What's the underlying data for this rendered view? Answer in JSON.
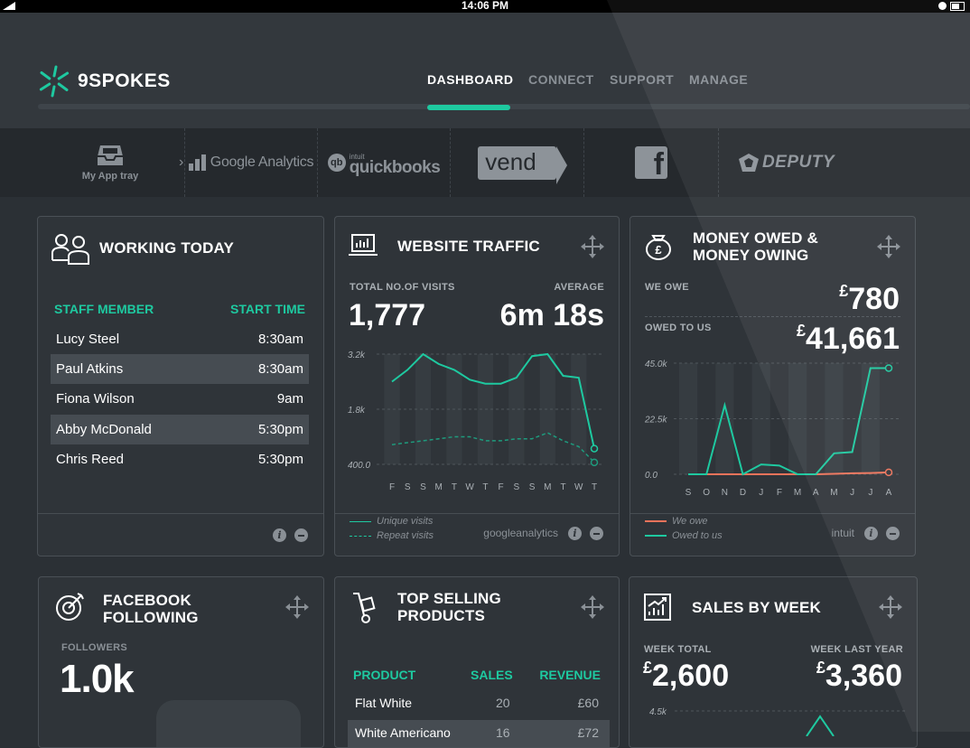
{
  "status_bar": {
    "time": "14:06 PM"
  },
  "brand": {
    "name": "9SPOKES"
  },
  "nav": {
    "tabs": [
      {
        "label": "DASHBOARD",
        "active": true
      },
      {
        "label": "CONNECT",
        "active": false
      },
      {
        "label": "SUPPORT",
        "active": false
      },
      {
        "label": "MANAGE",
        "active": false
      }
    ]
  },
  "apps": {
    "tray_label": "My App tray",
    "items": [
      {
        "name": "Google Analytics",
        "icon": "google-analytics-logo"
      },
      {
        "name": "quickbooks",
        "prefix": "intuit",
        "icon": "quickbooks-logo"
      },
      {
        "name": "vend",
        "icon": "vend-logo"
      },
      {
        "name": "f",
        "icon": "facebook-logo"
      },
      {
        "name": "DEPUTY",
        "icon": "deputy-logo"
      }
    ]
  },
  "working_today": {
    "title": "WORKING TODAY",
    "col_staff": "STAFF MEMBER",
    "col_time": "START TIME",
    "rows": [
      {
        "name": "Lucy Steel",
        "time": "8:30am"
      },
      {
        "name": "Paul Atkins",
        "time": "8:30am"
      },
      {
        "name": "Fiona Wilson",
        "time": "9am"
      },
      {
        "name": "Abby McDonald",
        "time": "5:30pm"
      },
      {
        "name": "Chris Reed",
        "time": "5:30pm"
      }
    ]
  },
  "website_traffic": {
    "title": "WEBSITE TRAFFIC",
    "visits_label": "TOTAL NO.OF VISITS",
    "visits_value": "1,777",
    "average_label": "AVERAGE",
    "average_value": "6m 18s",
    "legend_unique": "Unique visits",
    "legend_repeat": "Repeat visits",
    "source": "googleanalytics",
    "chart_data": {
      "type": "line",
      "categories": [
        "F",
        "S",
        "S",
        "M",
        "T",
        "W",
        "T",
        "F",
        "S",
        "S",
        "M",
        "T",
        "W",
        "T"
      ],
      "y_ticks": [
        "3.2k",
        "1.8k",
        "400.0"
      ],
      "ylim": [
        400,
        3200
      ],
      "series": [
        {
          "name": "Unique visits",
          "values": [
            2500,
            2800,
            3200,
            2950,
            2800,
            2550,
            2450,
            2450,
            2600,
            3150,
            3200,
            2650,
            2600,
            800
          ]
        },
        {
          "name": "Repeat visits",
          "values": [
            900,
            950,
            1000,
            1050,
            1100,
            1100,
            1000,
            1000,
            1050,
            1050,
            1200,
            1000,
            850,
            450
          ]
        }
      ],
      "colors": {
        "unique": "#1ec9a0",
        "repeat": "#1e9b7d"
      }
    }
  },
  "money_owed": {
    "title_line1": "MONEY OWED &",
    "title_line2": "MONEY OWING",
    "we_owe_label": "WE OWE",
    "we_owe_currency": "£",
    "we_owe_value": "780",
    "owed_to_us_label": "OWED TO US",
    "owed_to_us_currency": "£",
    "owed_to_us_value": "41,661",
    "legend_we_owe": "We owe",
    "legend_owed": "Owed to us",
    "source": "intuit",
    "chart_data": {
      "type": "line",
      "categories": [
        "S",
        "O",
        "N",
        "D",
        "J",
        "F",
        "M",
        "A",
        "M",
        "J",
        "J",
        "A"
      ],
      "y_ticks": [
        "45.0k",
        "22.5k",
        "0.0"
      ],
      "ylim": [
        0,
        45000
      ],
      "series": [
        {
          "name": "We owe",
          "values": [
            0,
            0,
            0,
            0,
            0,
            0,
            0,
            0,
            200,
            400,
            500,
            780
          ]
        },
        {
          "name": "Owed to us",
          "values": [
            0,
            0,
            28000,
            0,
            4000,
            3500,
            0,
            0,
            8500,
            9000,
            43000,
            43000
          ]
        }
      ],
      "colors": {
        "we_owe": "#f0735a",
        "owed_to_us": "#1ec9a0"
      }
    }
  },
  "facebook": {
    "title_line1": "FACEBOOK",
    "title_line2": "FOLLOWING",
    "followers_label": "FOLLOWERS",
    "followers_value": "1.0k"
  },
  "top_selling": {
    "title_line1": "TOP SELLING",
    "title_line2": "PRODUCTS",
    "col_product": "PRODUCT",
    "col_sales": "SALES",
    "col_revenue": "REVENUE",
    "rows": [
      {
        "product": "Flat White",
        "sales": "20",
        "revenue": "£60"
      },
      {
        "product": "White Americano",
        "sales": "16",
        "revenue": "£72"
      }
    ]
  },
  "sales_by_week": {
    "title": "SALES BY WEEK",
    "week_total_label": "WEEK TOTAL",
    "week_total_currency": "£",
    "week_total_value": "2,600",
    "last_year_label": "WEEK LAST YEAR",
    "last_year_currency": "£",
    "last_year_value": "3,360",
    "chart_data": {
      "type": "line",
      "y_ticks": [
        "4.5k"
      ]
    }
  },
  "colors": {
    "accent": "#1ec9a0",
    "background": "#2b3035",
    "card": "#2f3439",
    "coral": "#f0735a"
  }
}
